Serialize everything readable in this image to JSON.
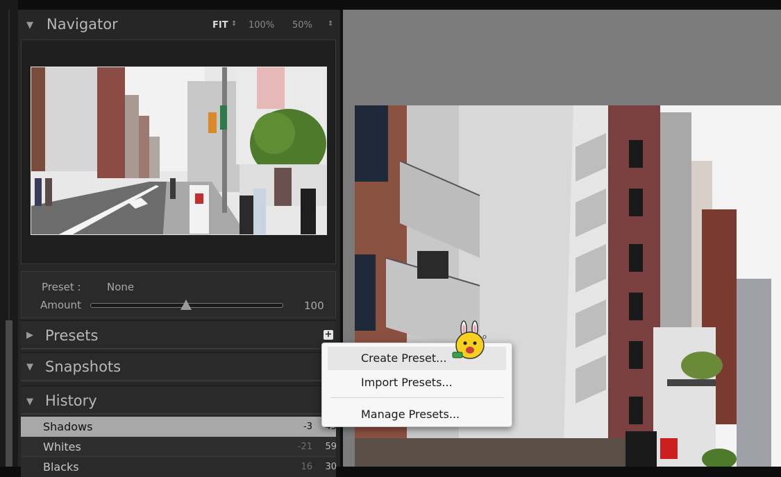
{
  "navigator": {
    "title": "Navigator",
    "zoom_fit": "FIT",
    "zoom_100": "100%",
    "zoom_50": "50%"
  },
  "preset": {
    "label": "Preset :",
    "value": "None",
    "amount_label": "Amount",
    "amount_value": "100",
    "amount_fraction": 0.5
  },
  "sections": {
    "presets": "Presets",
    "snapshots": "Snapshots",
    "history": "History"
  },
  "history": [
    {
      "name": "Shadows",
      "delta": "-3",
      "value": "45"
    },
    {
      "name": "Whites",
      "delta": "-21",
      "value": "59"
    },
    {
      "name": "Blacks",
      "delta": "16",
      "value": "30"
    }
  ],
  "menu": {
    "create": "Create Preset...",
    "import": "Import Presets...",
    "manage": "Manage Presets..."
  },
  "colors": {
    "panel_bg": "#262626",
    "selected_row": "#a8a8a8",
    "canvas_bg": "#7b7b7b",
    "menu_bg": "#f7f7f7"
  },
  "icons": {
    "collapse": "triangle-down-icon",
    "expand": "triangle-right-icon",
    "add": "plus-icon",
    "stepper": "up-down-arrows-icon"
  }
}
